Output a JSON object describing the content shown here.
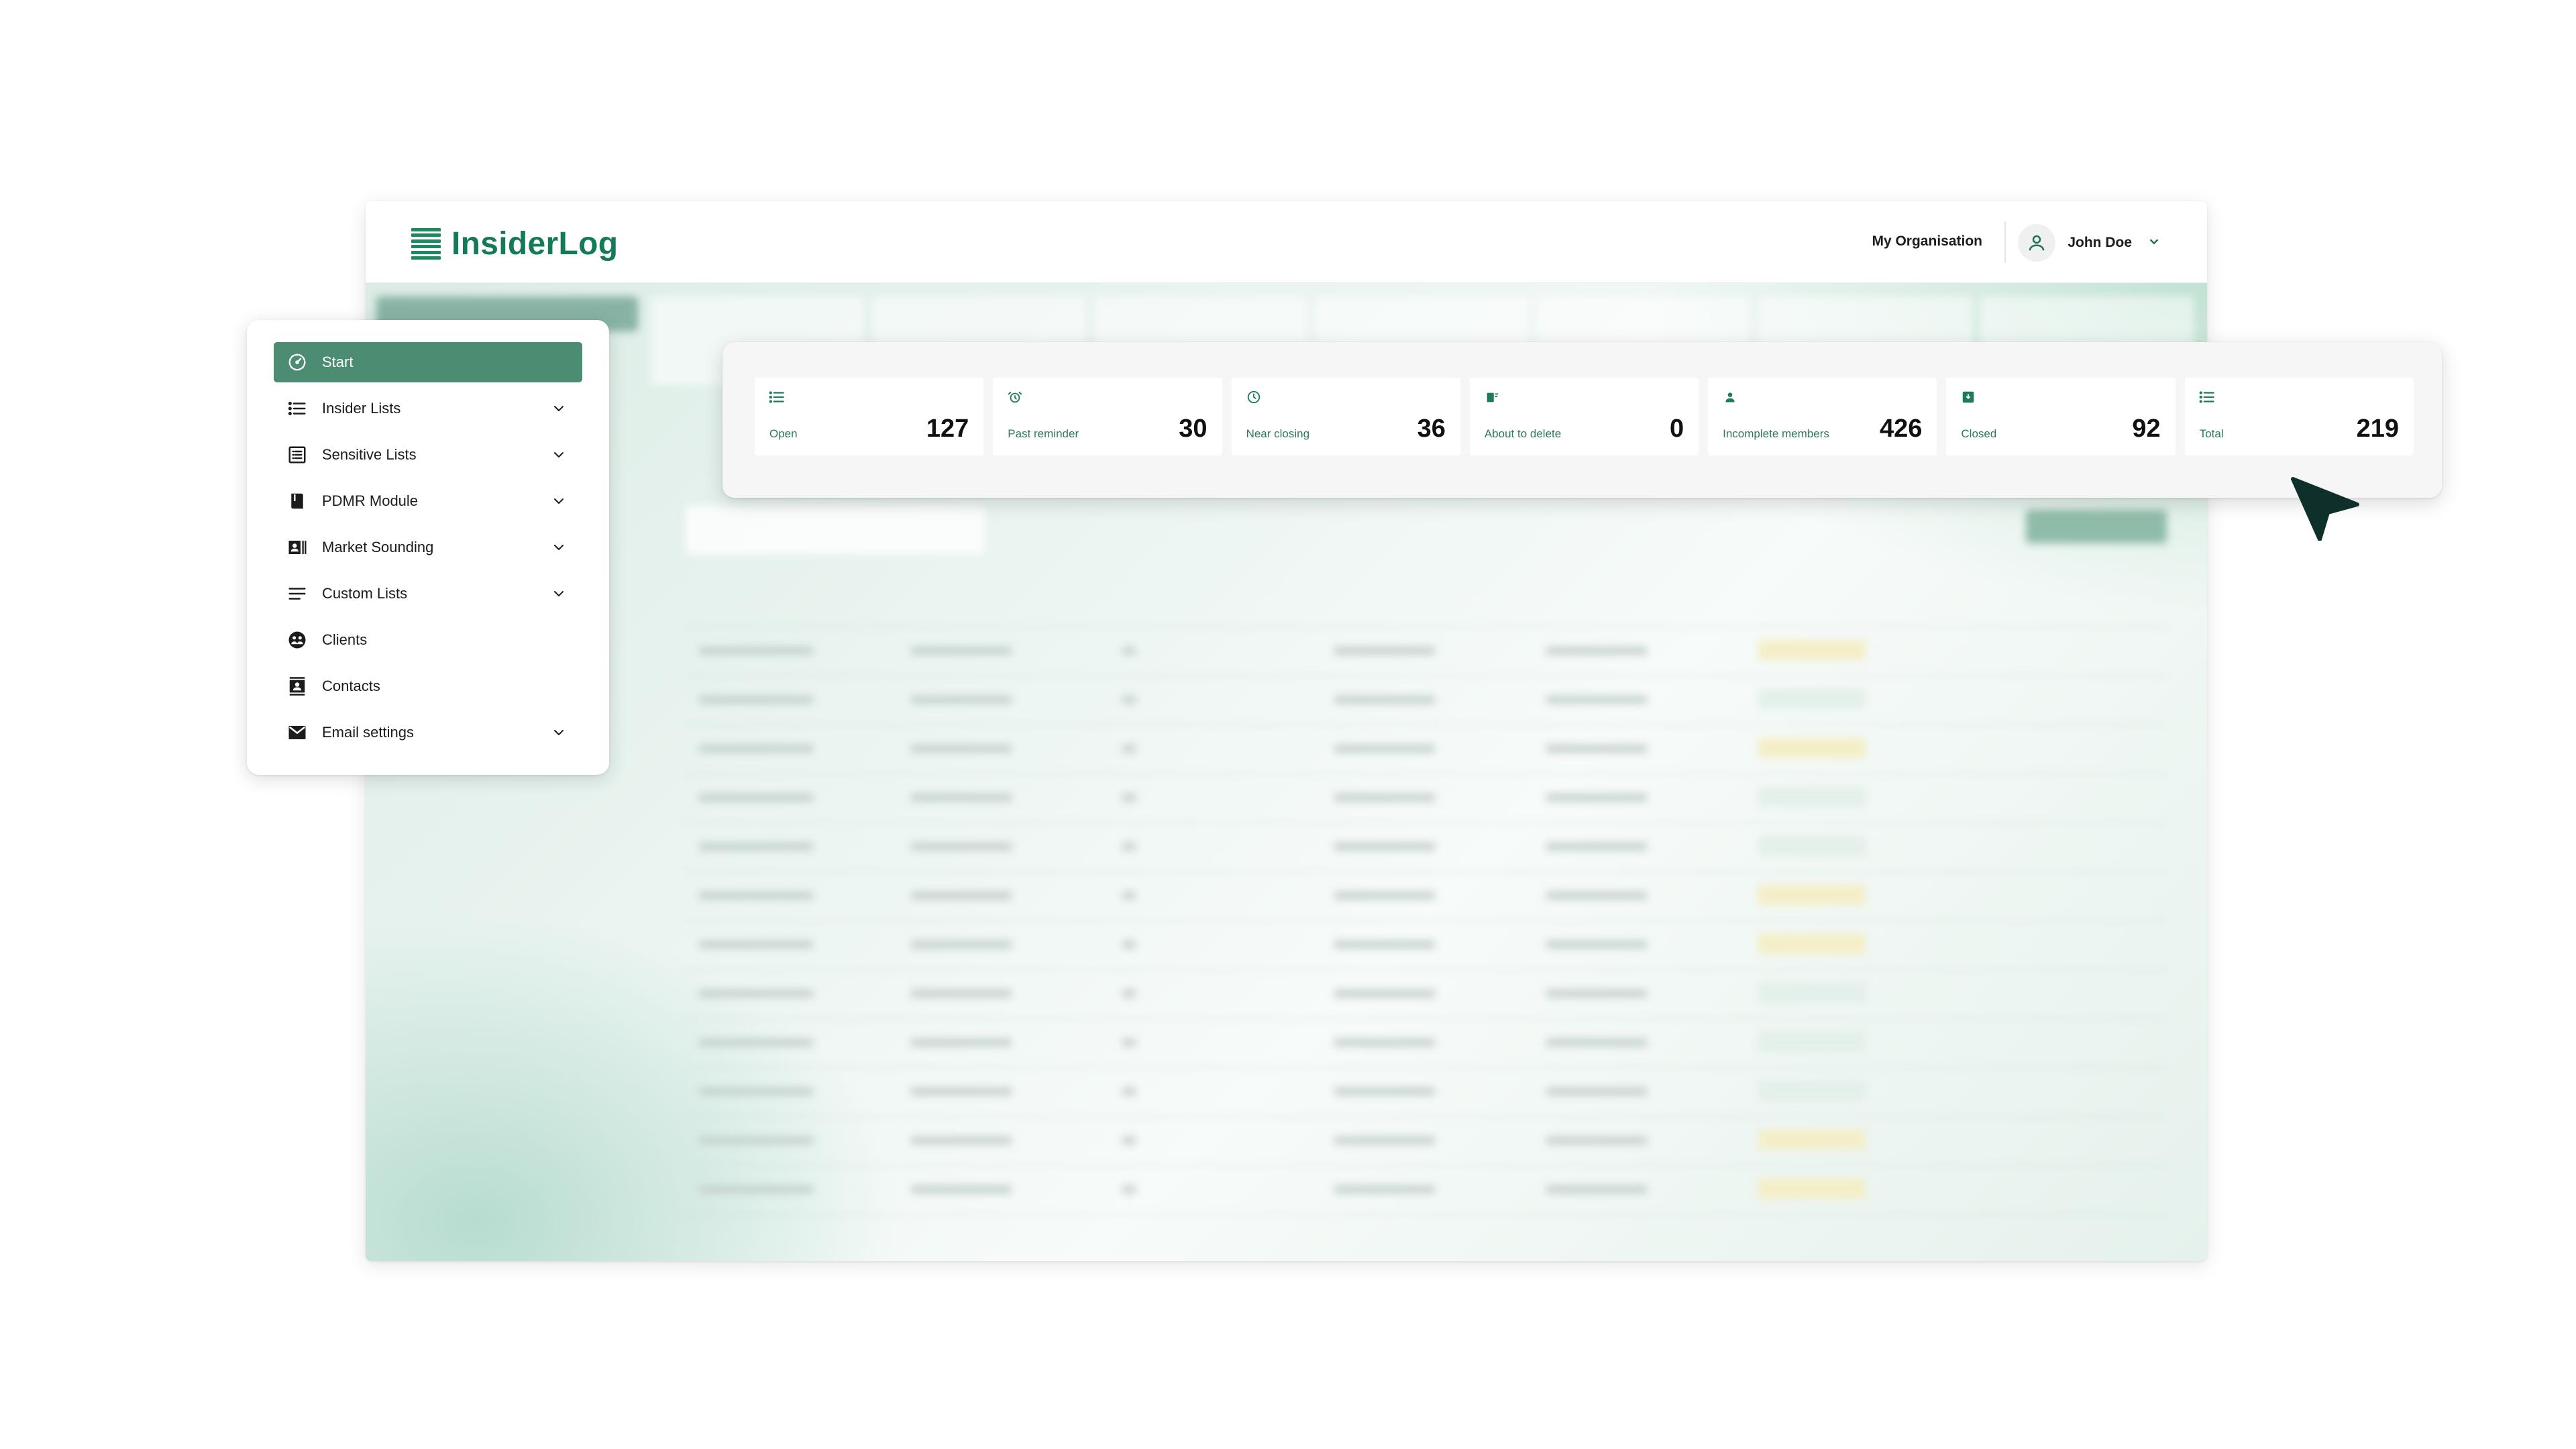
{
  "app": {
    "logo_text": "InsiderLog",
    "organisation_label": "My Organisation",
    "user_name": "John Doe"
  },
  "sidebar": {
    "items": [
      {
        "label": "Start",
        "icon": "dashboard-gauge-icon",
        "active": true,
        "expandable": false
      },
      {
        "label": "Insider Lists",
        "icon": "list-icon",
        "active": false,
        "expandable": true
      },
      {
        "label": "Sensitive Lists",
        "icon": "table-list-icon",
        "active": false,
        "expandable": true
      },
      {
        "label": "PDMR Module",
        "icon": "book-icon",
        "active": false,
        "expandable": true
      },
      {
        "label": "Market Sounding",
        "icon": "contact-card-icon",
        "active": false,
        "expandable": true
      },
      {
        "label": "Custom Lists",
        "icon": "lines-icon",
        "active": false,
        "expandable": true
      },
      {
        "label": "Clients",
        "icon": "clients-icon",
        "active": false,
        "expandable": false
      },
      {
        "label": "Contacts",
        "icon": "contacts-book-icon",
        "active": false,
        "expandable": false
      },
      {
        "label": "Email settings",
        "icon": "envelope-icon",
        "active": false,
        "expandable": true
      }
    ]
  },
  "stats": [
    {
      "label": "Open",
      "value": "127",
      "icon": "list-icon"
    },
    {
      "label": "Past reminder",
      "value": "30",
      "icon": "alarm-clock-icon"
    },
    {
      "label": "Near closing",
      "value": "36",
      "icon": "clock-icon"
    },
    {
      "label": "About to delete",
      "value": "0",
      "icon": "trash-icon"
    },
    {
      "label": "Incomplete members",
      "value": "426",
      "icon": "person-icon"
    },
    {
      "label": "Closed",
      "value": "92",
      "icon": "closed-box-icon"
    },
    {
      "label": "Total",
      "value": "219",
      "icon": "list-icon"
    }
  ],
  "colors": {
    "brand": "#157a58",
    "active_nav": "#4b8c73",
    "cursor": "#0f2f2a",
    "stat_label": "#2e7a5d"
  }
}
